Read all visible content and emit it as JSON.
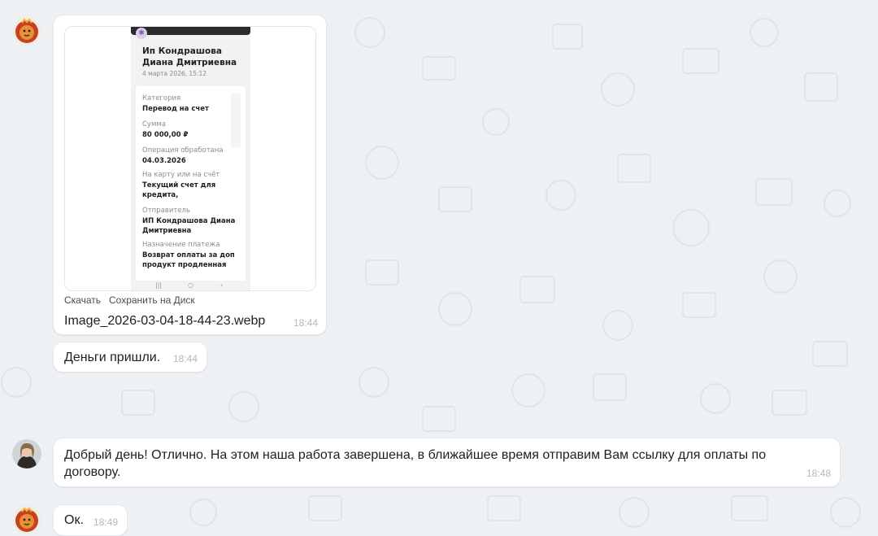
{
  "colors": {
    "background": "#eef1f4",
    "bubble": "#ffffff",
    "time": "#b3b7bd",
    "link": "#4a4d52"
  },
  "messages": {
    "image_message": {
      "avatar": "lion-avatar",
      "actions": {
        "download": "Скачать",
        "save_to_disk": "Сохранить на Диск"
      },
      "filename": "Image_2026-03-04-18-44-23.webp",
      "time": "18:44",
      "receipt": {
        "title": "Ип Кондрашова Диана Дмитриевна",
        "date": "4 марта 2026, 15:12",
        "category_label": "Категория",
        "category_value": "Перевод на счет",
        "amount_label": "Сумма",
        "amount_value": "80 000,00 ₽",
        "processed_label": "Операция обработана",
        "processed_value": "04.03.2026",
        "to_label": "На карту или на счёт",
        "to_value": "Текущий счет для кредита,",
        "sender_label": "Отправитель",
        "sender_value": "ИП Кондрашова Диана Дмитриевна",
        "purpose_label": "Назначение платежа",
        "purpose_value": "Возврат оплаты за доп продукт продленная"
      }
    },
    "money_message": {
      "text": "Деньги пришли.",
      "time": "18:44"
    },
    "reply_message": {
      "avatar": "woman-avatar",
      "text": "Добрый день! Отлично. На этом наша работа завершена, в ближайшее время отправим Вам ссылку для оплаты по договору.",
      "time": "18:48"
    },
    "ok_message": {
      "avatar": "lion-avatar",
      "text": "Ок.",
      "time": "18:49"
    }
  }
}
